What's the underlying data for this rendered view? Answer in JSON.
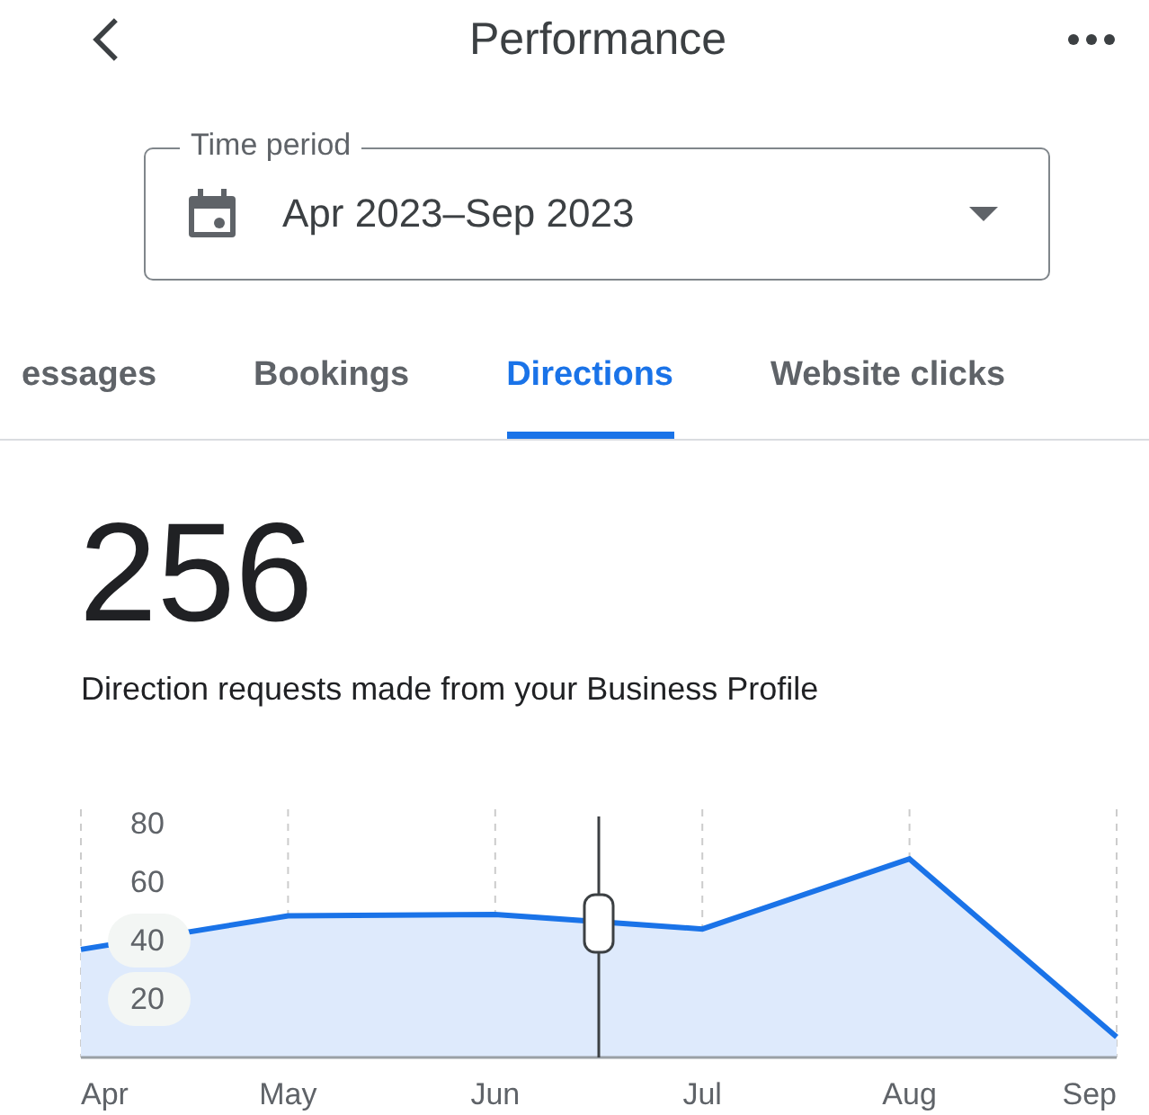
{
  "header": {
    "title": "Performance"
  },
  "time_period": {
    "label": "Time period",
    "value": "Apr 2023–Sep 2023"
  },
  "tabs": [
    {
      "label": "essages",
      "selected": false
    },
    {
      "label": "Bookings",
      "selected": false
    },
    {
      "label": "Directions",
      "selected": true
    },
    {
      "label": "Website clicks",
      "selected": false
    }
  ],
  "total": "256",
  "description": "Direction requests made from your Business Profile",
  "chart_data": {
    "type": "area",
    "categories": [
      "Apr",
      "May",
      "Jun",
      "Jul",
      "Aug",
      "Sep"
    ],
    "series": [
      {
        "color": "#1a73e8",
        "values": [
          37,
          48.5,
          49,
          44,
          68,
          7
        ]
      }
    ],
    "ylim": [
      0,
      85
    ],
    "yticks": [
      20,
      40,
      60,
      80
    ],
    "grid": true
  }
}
